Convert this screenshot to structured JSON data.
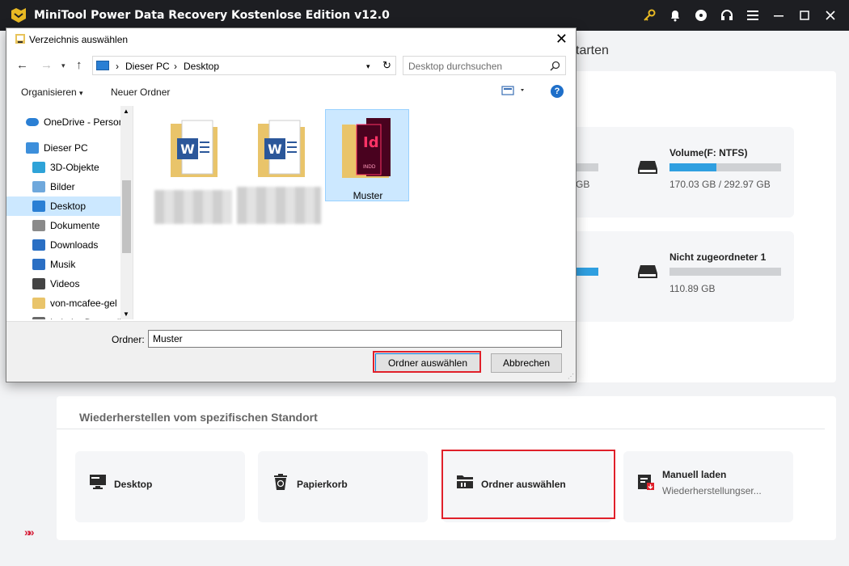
{
  "app": {
    "title": "MiniTool Power Data Recovery Kostenlose Edition v12.0",
    "starten_text": "tarten"
  },
  "drives": [
    {
      "name": "",
      "size": "GB",
      "fill": 0.0
    },
    {
      "name": "Volume(F: NTFS)",
      "size": "170.03 GB / 292.97 GB",
      "fill": 0.42
    },
    {
      "name": "",
      "size": "",
      "fill": 1.0
    },
    {
      "name": "Nicht zugeordneter 1",
      "size": "110.89 GB",
      "fill": 0.0
    }
  ],
  "locations": {
    "section_title": "Wiederherstellen vom spezifischen Standort",
    "items": [
      {
        "label": "Desktop",
        "icon": "monitor-icon"
      },
      {
        "label": "Papierkorb",
        "icon": "recycle-bin-icon"
      },
      {
        "label": "Ordner auswählen",
        "icon": "folder-select-icon"
      },
      {
        "label": "Manuell laden",
        "sub": "Wiederherstellungser...",
        "icon": "manual-load-icon"
      }
    ]
  },
  "dialog": {
    "title": "Verzeichnis auswählen",
    "address": {
      "part1": "Dieser PC",
      "part2": "Desktop"
    },
    "search_placeholder": "Desktop durchsuchen",
    "organize": "Organisieren",
    "new_folder": "Neuer Ordner",
    "nav": [
      {
        "label": "OneDrive - Person",
        "icon": "onedrive-icon"
      },
      {
        "label": "Dieser PC",
        "icon": "this-pc-icon"
      },
      {
        "label": "3D-Objekte",
        "icon": "3d-objects-icon"
      },
      {
        "label": "Bilder",
        "icon": "pictures-icon"
      },
      {
        "label": "Desktop",
        "icon": "desktop-icon"
      },
      {
        "label": "Dokumente",
        "icon": "documents-icon"
      },
      {
        "label": "Downloads",
        "icon": "downloads-icon"
      },
      {
        "label": "Musik",
        "icon": "music-icon"
      },
      {
        "label": "Videos",
        "icon": "videos-icon"
      },
      {
        "label": "von-mcafee-gel",
        "icon": "folder-icon"
      },
      {
        "label": "Lokaler Datenträ",
        "icon": "local-disk-icon"
      }
    ],
    "files": [
      {
        "label": "",
        "type": "word"
      },
      {
        "label": "",
        "type": "word"
      },
      {
        "label": "Muster",
        "type": "indesign"
      }
    ],
    "folder_label": "Ordner:",
    "folder_value": "Muster",
    "select_button": "Ordner auswählen",
    "cancel_button": "Abbrechen"
  },
  "colors": {
    "accent": "#2f9fe0",
    "highlight": "#e0202a",
    "titlebar": "#1d1e22"
  }
}
